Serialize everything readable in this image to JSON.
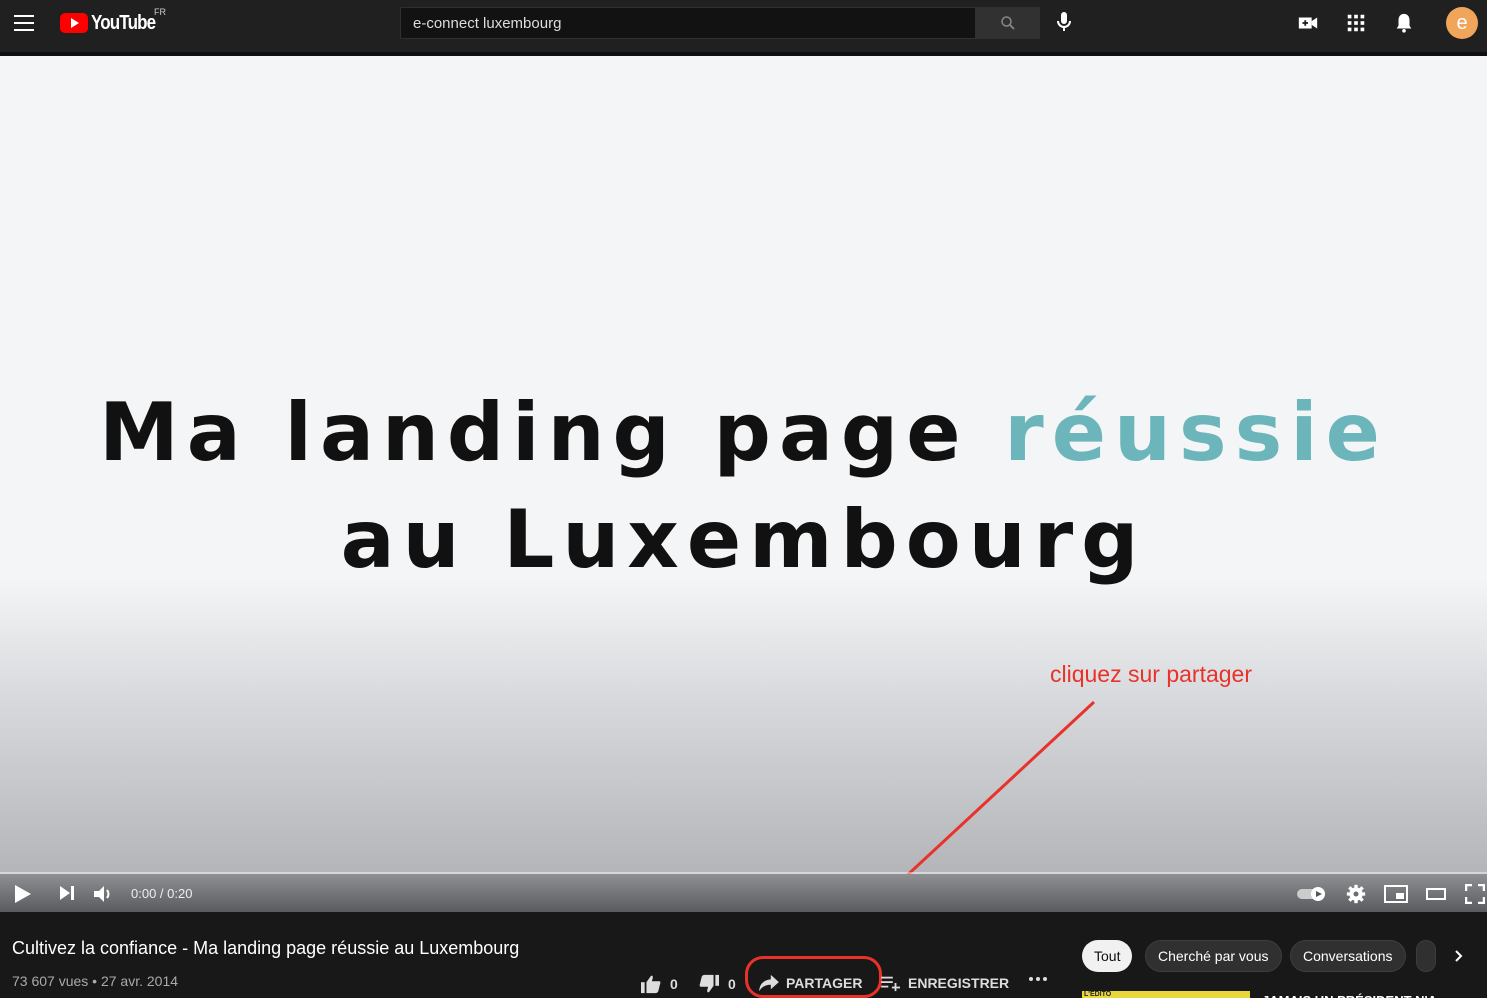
{
  "header": {
    "logo_text": "YouTube",
    "country_code": "FR",
    "search_value": "e-connect luxembourg",
    "avatar_letter": "e"
  },
  "video": {
    "title_line1_main": "Ma landing page ",
    "title_line1_accent": "réussie",
    "title_line2": "au Luxembourg",
    "accent_color": "#6cb6bb",
    "time": "0:00 / 0:20"
  },
  "annotation": {
    "text": "cliquez sur partager",
    "color": "#e8322a"
  },
  "info": {
    "title": "Cultivez la confiance - Ma landing page réussie au Luxembourg",
    "meta": "73 607 vues • 27 avr. 2014",
    "likes": "0",
    "dislikes": "0",
    "share_label": "PARTAGER",
    "save_label": "ENREGISTRER"
  },
  "chips": [
    "Tout",
    "Cherché par vous",
    "Conversations"
  ],
  "recommendation": {
    "thumb_label": "L'ÉDITO",
    "title": "JAMAIS UN PRÉSIDENT N'A"
  }
}
